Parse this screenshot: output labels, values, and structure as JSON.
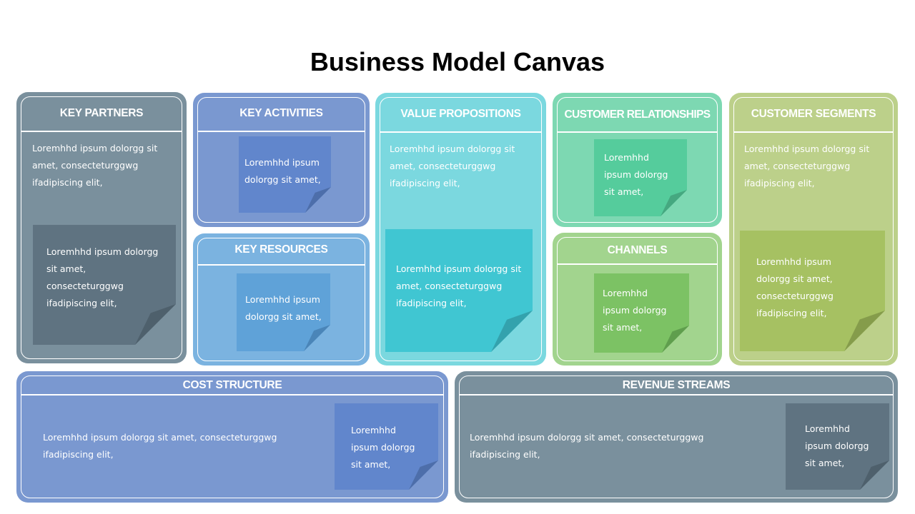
{
  "title": "Business Model Canvas",
  "colors": {
    "slate": "#7a909d",
    "slate_note": "#5f7381",
    "slate_fold": "#4e606c",
    "blue": "#7a98d0",
    "blue_note": "#6186cc",
    "blue_fold": "#4d6eaa",
    "sky": "#7bb3e0",
    "sky_note": "#5fa2d8",
    "sky_fold": "#4a85b8",
    "cyan": "#7bd8df",
    "cyan_note": "#40c6d2",
    "cyan_fold": "#33a2ad",
    "mint": "#7dd8b2",
    "mint_note": "#55cc9c",
    "mint_fold": "#45a880",
    "green": "#a2d48e",
    "green_note": "#7cc264",
    "green_fold": "#5f9e4d",
    "olive": "#bcd08a",
    "olive_note": "#a6c162",
    "olive_fold": "#859c4b"
  },
  "blocks": {
    "key_partners": {
      "heading": "KEY PARTNERS",
      "text_lines": [
        "Loremhhd ipsum dolorgg sit",
        "amet, consecteturggwg",
        "ifadipiscing  elit,"
      ],
      "note_lines": [
        "Loremhhd ipsum dolorgg",
        "sit amet,",
        "consecteturggwg",
        "ifadipiscing  elit,"
      ]
    },
    "key_activities": {
      "heading": "KEY ACTIVITIES",
      "note_lines": [
        "Loremhhd ipsum",
        "dolorgg sit amet,"
      ]
    },
    "key_resources": {
      "heading": "KEY RESOURCES",
      "note_lines": [
        "Loremhhd ipsum",
        "dolorgg sit amet,"
      ]
    },
    "value_propositions": {
      "heading": "VALUE PROPOSITIONS",
      "text_lines": [
        "Loremhhd ipsum dolorgg sit",
        "amet, consecteturggwg",
        "ifadipiscing  elit,"
      ],
      "note_lines": [
        "Loremhhd ipsum dolorgg sit",
        "amet, consecteturggwg",
        "ifadipiscing  elit,"
      ]
    },
    "customer_relationships": {
      "heading": "CUSTOMER RELATIONSHIPS",
      "note_lines": [
        "Loremhhd",
        "ipsum dolorgg",
        "sit amet,"
      ]
    },
    "channels": {
      "heading": "CHANNELS",
      "note_lines": [
        "Loremhhd",
        "ipsum dolorgg",
        "sit amet,"
      ]
    },
    "customer_segments": {
      "heading": "CUSTOMER SEGMENTS",
      "text_lines": [
        "Loremhhd ipsum dolorgg sit",
        "amet, consecteturggwg",
        "ifadipiscing  elit,"
      ],
      "note_lines": [
        "Loremhhd ipsum",
        "dolorgg sit amet,",
        "consecteturggwg",
        "ifadipiscing  elit,"
      ]
    },
    "cost_structure": {
      "heading": "COST STRUCTURE",
      "text_lines": [
        "Loremhhd ipsum dolorgg sit amet, consecteturggwg",
        "ifadipiscing  elit,"
      ],
      "note_lines": [
        "Loremhhd",
        "ipsum dolorgg",
        "sit amet,"
      ]
    },
    "revenue_streams": {
      "heading": "REVENUE STREAMS",
      "text_lines": [
        "Loremhhd ipsum dolorgg sit amet, consecteturggwg",
        "ifadipiscing  elit,"
      ],
      "note_lines": [
        "Loremhhd",
        "ipsum dolorgg",
        "sit amet,"
      ]
    }
  }
}
